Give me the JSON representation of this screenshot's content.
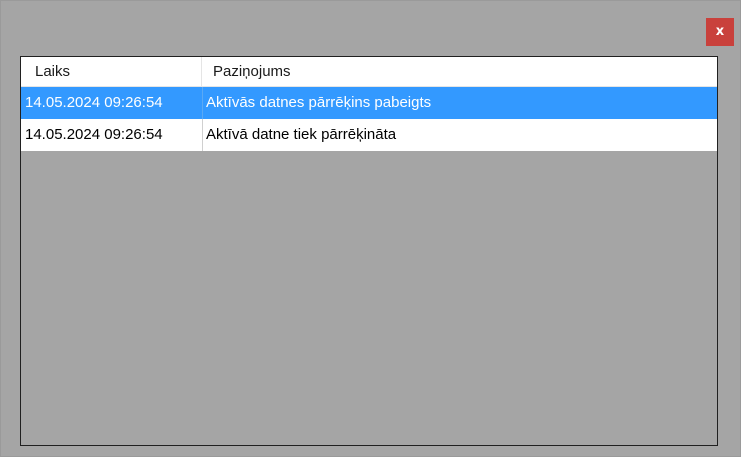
{
  "window": {
    "close_label": "x"
  },
  "list": {
    "columns": [
      "Laiks",
      "Paziņojums"
    ],
    "rows": [
      {
        "time": "14.05.2024 09:26:54",
        "message": "Aktīvās datnes pārrēķins pabeigts",
        "selected": true
      },
      {
        "time": "14.05.2024 09:26:54",
        "message": "Aktīvā datne tiek pārrēķināta",
        "selected": false
      }
    ]
  },
  "colors": {
    "window_background": "#a5a5a5",
    "close_button": "#c9413c",
    "selection": "#3399ff"
  }
}
